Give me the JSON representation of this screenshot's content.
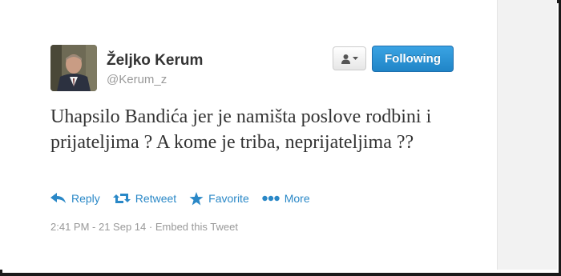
{
  "tweet": {
    "author_name": "Željko Kerum",
    "author_handle": "@Kerum_z",
    "follow_label": "Following",
    "text": "Uhapsilo Bandića jer je namišta poslove rodbini i prijateljima ? A kome je triba, neprijateljima ??",
    "actions": {
      "reply": "Reply",
      "retweet": "Retweet",
      "favorite": "Favorite",
      "more": "More"
    },
    "timestamp": "2:41 PM - 21 Sep 14",
    "separator": "·",
    "embed_label": "Embed this Tweet"
  },
  "colors": {
    "link_blue": "#2a88c7",
    "follow_button": "#2a8fd4",
    "name_text": "#333333",
    "muted_text": "#999999"
  },
  "icons": [
    "person-dropdown-icon",
    "reply-icon",
    "retweet-icon",
    "favorite-star-icon",
    "more-dots-icon"
  ]
}
